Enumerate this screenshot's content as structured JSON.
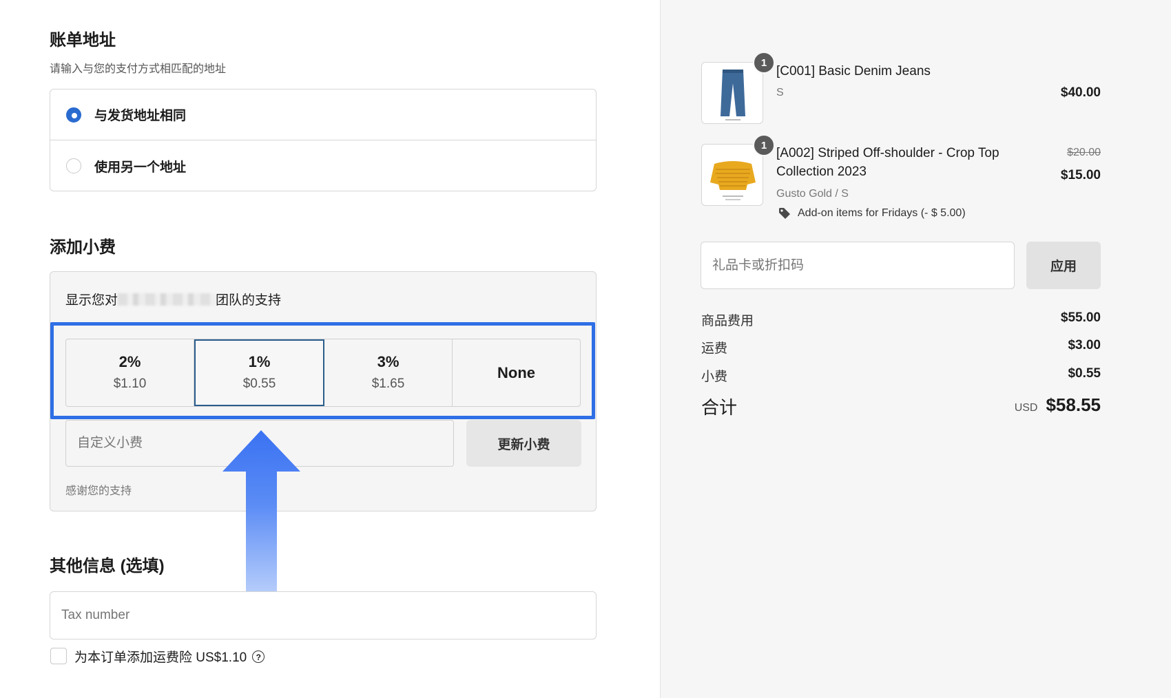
{
  "billing": {
    "title": "账单地址",
    "subtitle": "请输入与您的支付方式相匹配的地址",
    "options": [
      {
        "label": "与发货地址相同",
        "selected": true
      },
      {
        "label": "使用另一个地址",
        "selected": false
      }
    ]
  },
  "tip": {
    "title": "添加小费",
    "support_prefix": "显示您对",
    "support_suffix": "团队的支持",
    "options": [
      {
        "percent": "2%",
        "amount": "$1.10"
      },
      {
        "percent": "1%",
        "amount": "$0.55",
        "selected": true
      },
      {
        "percent": "3%",
        "amount": "$1.65"
      },
      {
        "percent": "None",
        "amount": ""
      }
    ],
    "custom_placeholder": "自定义小费",
    "update_label": "更新小费",
    "thanks": "感谢您的支持"
  },
  "other": {
    "title": "其他信息 (选填)",
    "tax_placeholder": "Tax number",
    "insurance_label": "为本订单添加运费险 US$1.10",
    "help_glyph": "?"
  },
  "cart": {
    "items": [
      {
        "qty": "1",
        "name": "[C001] Basic Denim Jeans",
        "variant": "S",
        "price": "$40.00",
        "image": "jeans-thumbnail"
      },
      {
        "qty": "1",
        "name_line1": "[A002] Striped Off-shoulder - Crop Top",
        "name_line2": "Collection 2023",
        "variant": "Gusto Gold / S",
        "original_price": "$20.00",
        "price": "$15.00",
        "discount": "Add-on items for Fridays (- $ 5.00)",
        "image": "sweater-thumbnail"
      }
    ],
    "gift_placeholder": "礼品卡或折扣码",
    "apply_label": "应用"
  },
  "summary": {
    "subtotal_label": "商品费用",
    "subtotal": "$55.00",
    "shipping_label": "运费",
    "shipping": "$3.00",
    "tip_label": "小费",
    "tip": "$0.55",
    "total_label": "合计",
    "currency": "USD",
    "total": "$58.55"
  },
  "colors": {
    "accent": "#2a6bd0",
    "highlight": "#2f6fe6",
    "selected_border": "#2b5d8c"
  }
}
